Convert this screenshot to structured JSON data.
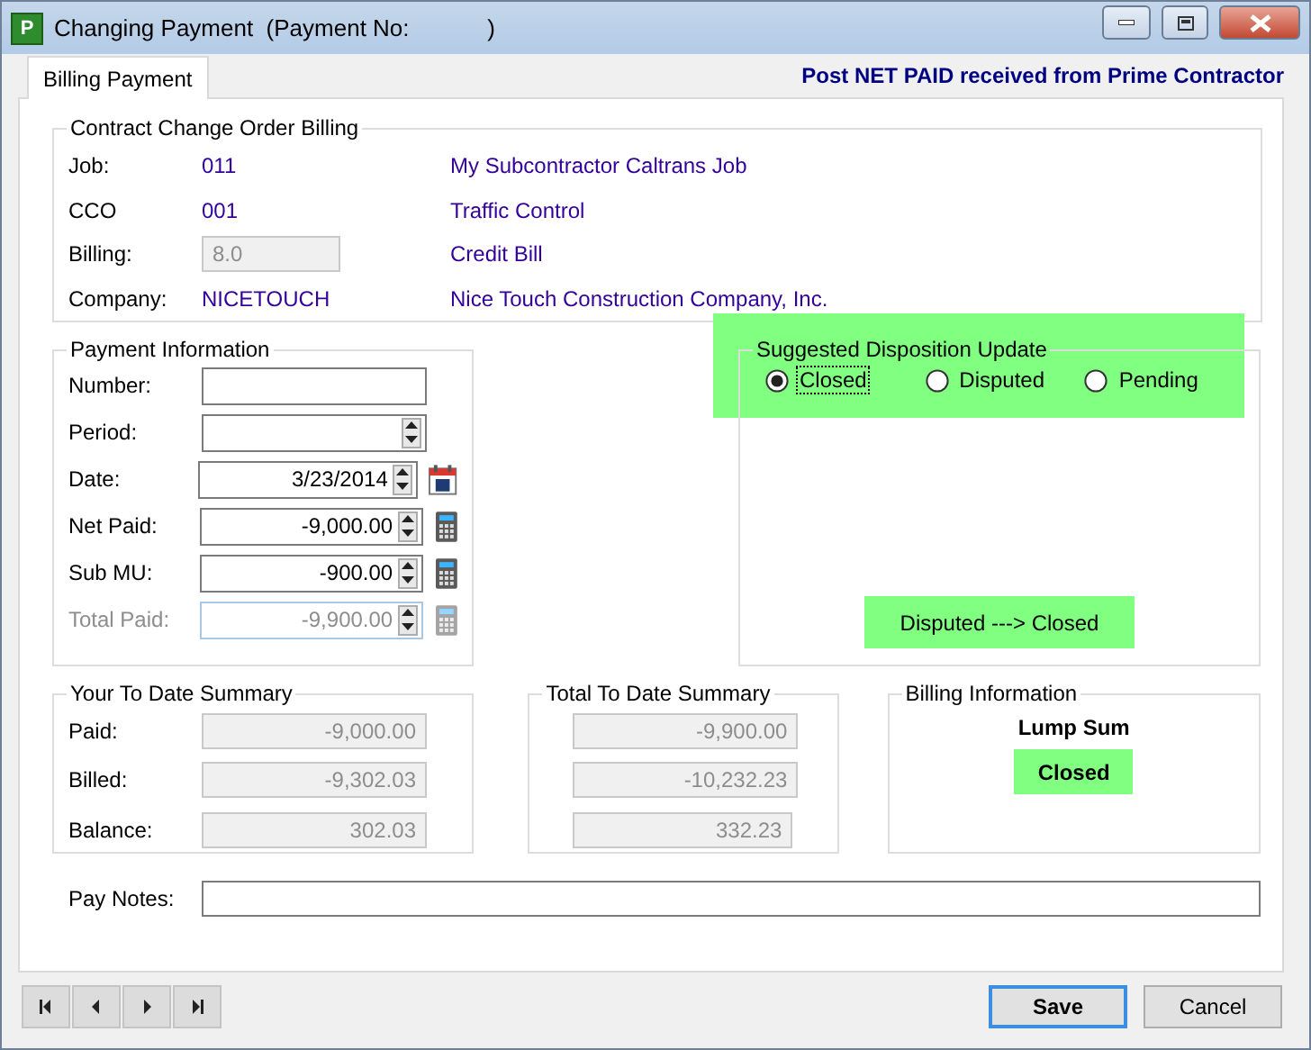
{
  "window": {
    "app_icon_letter": "P",
    "title": "Changing Payment  (Payment No:            )"
  },
  "tabs": [
    {
      "label": "Billing Payment",
      "selected": true
    }
  ],
  "header_note": "Post NET PAID received from Prime Contractor",
  "contract_billing": {
    "title": "Contract Change Order Billing",
    "rows": [
      {
        "label": "Job:",
        "value": "011",
        "description": "My Subcontractor Caltrans Job",
        "kind": "text"
      },
      {
        "label": "CCO",
        "value": "001",
        "description": "Traffic Control",
        "kind": "text"
      },
      {
        "label": "Billing:",
        "value": "8.0",
        "description": "Credit Bill",
        "kind": "field"
      },
      {
        "label": "Company:",
        "value": "NICETOUCH",
        "description": "Nice Touch Construction Company, Inc.",
        "kind": "text"
      }
    ]
  },
  "payment_information": {
    "title": "Payment Information",
    "fields": [
      {
        "label": "Number:",
        "kind": "plain",
        "disabled": false
      },
      {
        "label": "Period:",
        "kind": "spin",
        "disabled": false
      },
      {
        "label": "Date:",
        "value": "3/23/2014",
        "kind": "date",
        "disabled": false
      },
      {
        "label": "Net Paid:",
        "value": "-9,000.00",
        "kind": "calc",
        "disabled": false
      },
      {
        "label": "Sub MU:",
        "value": "-900.00",
        "kind": "calc",
        "disabled": false
      },
      {
        "label": "Total Paid:",
        "value": "-9,900.00",
        "kind": "calc",
        "disabled": true
      }
    ]
  },
  "disposition": {
    "title": "Suggested Disposition Update",
    "options": [
      {
        "label": "Closed",
        "selected": true
      },
      {
        "label": "Disputed",
        "selected": false
      },
      {
        "label": "Pending",
        "selected": false
      }
    ],
    "status": "Disputed ---> Closed"
  },
  "your_to_date_summary": {
    "title": "Your To Date Summary",
    "rows": [
      {
        "label": "Paid:",
        "value": "-9,000.00"
      },
      {
        "label": "Billed:",
        "value": "-9,302.03"
      },
      {
        "label": "Balance:",
        "value": "302.03"
      }
    ]
  },
  "total_to_date_summary": {
    "title": "Total To Date Summary",
    "values": [
      "-9,900.00",
      "-10,232.23",
      "332.23"
    ]
  },
  "billing_information": {
    "title": "Billing Information",
    "type": "Lump Sum",
    "status": "Closed"
  },
  "pay_notes": {
    "label": "Pay Notes:"
  },
  "buttons": [
    {
      "label": "Save",
      "default": true
    },
    {
      "label": "Cancel",
      "default": false
    }
  ]
}
